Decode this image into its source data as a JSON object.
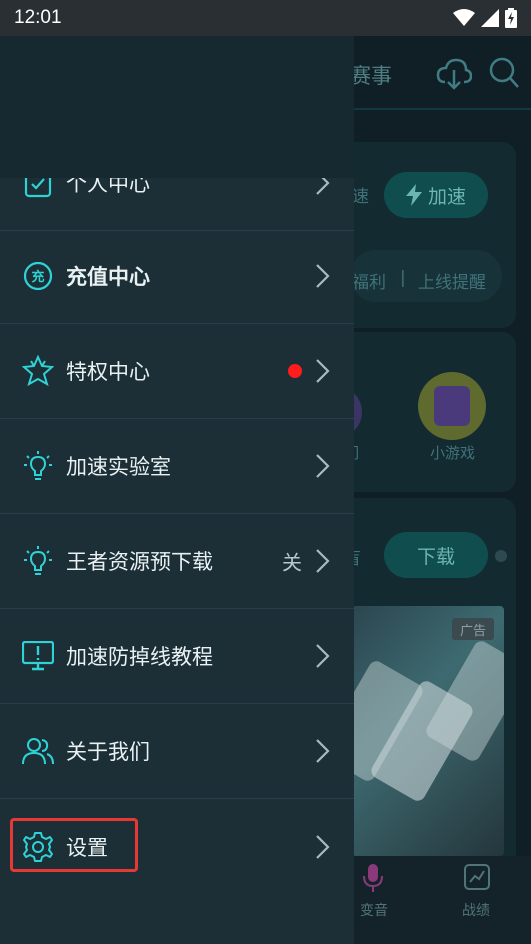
{
  "status_bar": {
    "time": "12:01",
    "icons": [
      "wifi-icon",
      "signal-icon",
      "battery-charging-icon"
    ]
  },
  "background": {
    "header_tab": "赛事",
    "card1": {
      "left_fragment": "速",
      "accel_button": "加速",
      "welfare": "福利",
      "separator": "|",
      "online_reminder": "上线提醒"
    },
    "card2": {
      "left_fragment": "们",
      "mini_game": "小游戏"
    },
    "card3": {
      "left_fragment": "盲",
      "download_button": "下载",
      "ad_label": "广告"
    },
    "bottom_nav": {
      "voice_change": "变音",
      "record": "战绩"
    }
  },
  "drawer": {
    "items": [
      {
        "label": "个人中心",
        "icon": "clipboard-icon"
      },
      {
        "label": "充值中心",
        "icon": "recharge-icon",
        "bold": true
      },
      {
        "label": "特权中心",
        "icon": "star-badge-icon",
        "red_dot": true
      },
      {
        "label": "加速实验室",
        "icon": "lightbulb-icon"
      },
      {
        "label": "王者资源预下载",
        "icon": "lightbulb-icon",
        "value": "关"
      },
      {
        "label": "加速防掉线教程",
        "icon": "monitor-alert-icon"
      },
      {
        "label": "关于我们",
        "icon": "users-icon"
      },
      {
        "label": "设置",
        "icon": "gear-icon",
        "highlighted": true
      }
    ]
  },
  "colors": {
    "accent": "#2fd3d6",
    "highlight": "#e53935",
    "red_dot": "#ff1c1c"
  }
}
